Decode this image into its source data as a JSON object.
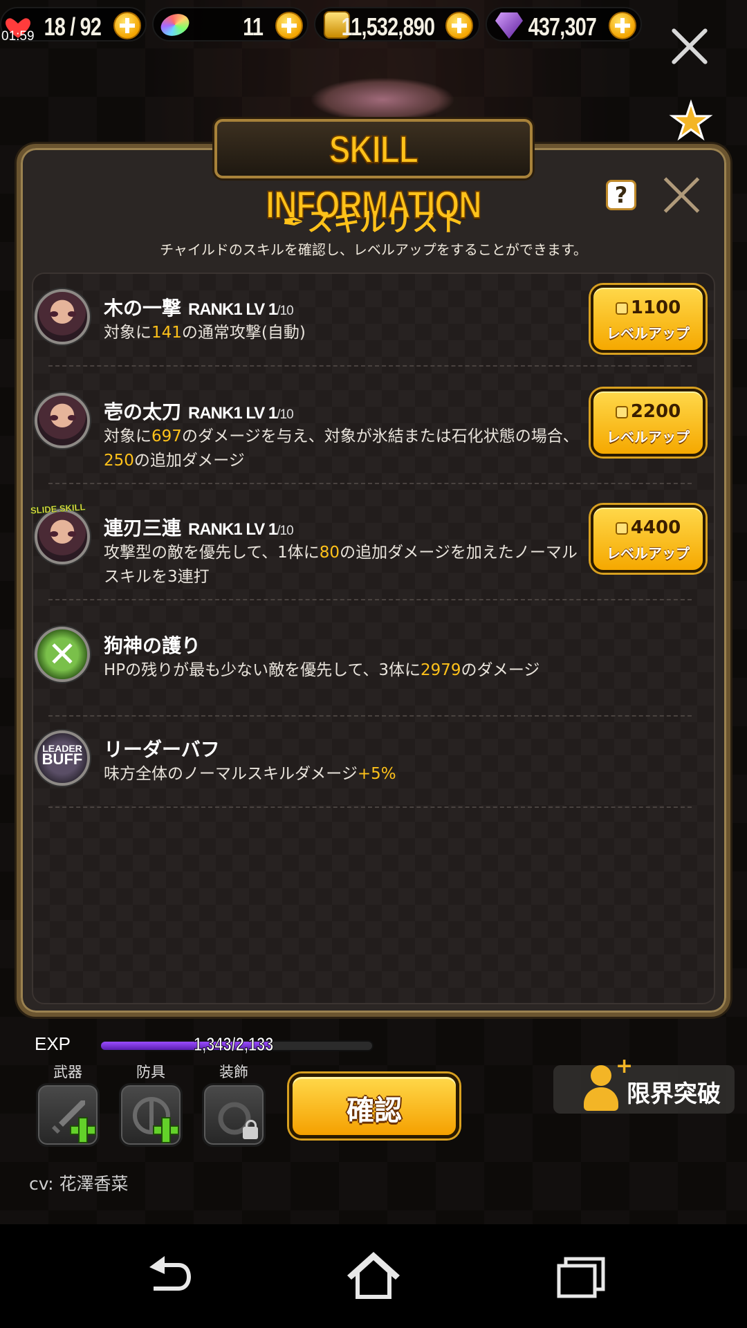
{
  "status": {
    "clock": "01:59"
  },
  "resources": {
    "stamina": "18 / 92",
    "crystal": "11",
    "gold": "11,532,890",
    "gem": "437,307"
  },
  "header": {
    "title": "SKILL INFORMATION"
  },
  "skill_list": {
    "title": "スキルリスト",
    "subtitle": "チャイルドのスキルを確認し、レベルアップをすることができます。",
    "help_label": "?",
    "level_up_label": "レベルアップ",
    "skills": [
      {
        "name": "木の一撃",
        "rank": "RANK1",
        "lv": "LV 1",
        "lv_max": "/10",
        "desc_pre": "対象に",
        "desc_v1": "141",
        "desc_post": "の通常攻撃(自動)",
        "cost": "1100"
      },
      {
        "name": "壱の太刀",
        "rank": "RANK1",
        "lv": "LV 1",
        "lv_max": "/10",
        "desc_pre": "対象に",
        "desc_v1": "697",
        "desc_mid": "のダメージを与え、対象が氷結または石化状態の場合、",
        "desc_v2": "250",
        "desc_post": "の追加ダメージ",
        "cost": "2200"
      },
      {
        "name": "連刃三連",
        "rank": "RANK1",
        "lv": "LV 1",
        "lv_max": "/10",
        "tag": "SLIDE SKILL",
        "desc_pre": "攻撃型の敵を優先して、1体に",
        "desc_v1": "80",
        "desc_post": "の追加ダメージを加えたノーマルスキルを3連打",
        "cost": "4400"
      },
      {
        "name": "狗神の護り",
        "desc_pre": "HPの残りが最も少ない敵を優先して、3体に",
        "desc_v1": "2979",
        "desc_post": "のダメージ"
      },
      {
        "name": "リーダーバフ",
        "icon_top": "LEADER",
        "icon_bottom": "BUFF",
        "desc_pre": "味方全体のノーマルスキルダメージ",
        "desc_v1": "+5%"
      }
    ]
  },
  "bottom": {
    "exp_label": "EXP",
    "exp_text": "1,343/2,133",
    "exp_progress": 0.63,
    "equip_labels": [
      "武器",
      "防具",
      "装飾"
    ],
    "confirm_label": "確認",
    "limit_break_label": "限界突破",
    "cv": "cv: 花澤香菜"
  },
  "icons": [
    "heart-icon",
    "rainbow-crystal-icon",
    "gold-coin-icon",
    "purple-gem-icon",
    "plus-icon",
    "close-icon",
    "star-icon",
    "help-icon",
    "feather-icon",
    "sword-icon",
    "shield-icon",
    "ring-icon",
    "lock-icon",
    "person-plus-icon",
    "back-icon",
    "home-icon",
    "recents-icon"
  ],
  "colors": {
    "accent": "#ffc21a",
    "highlight": "#ffc21a",
    "exp": "#8a3cff",
    "equip_plus": "#63d12a"
  }
}
